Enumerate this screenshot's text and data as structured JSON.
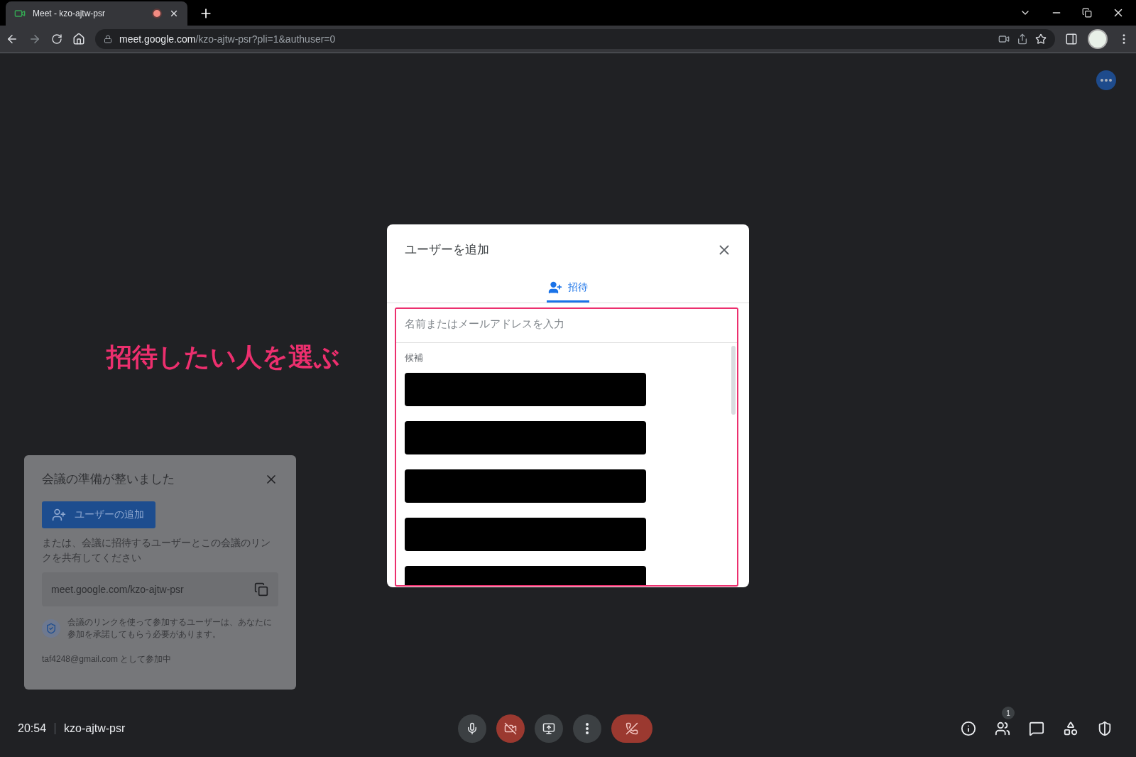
{
  "browser": {
    "tab": {
      "title": "Meet - kzo-ajtw-psr",
      "recording": true
    },
    "url": {
      "host": "meet.google.com",
      "path": "/kzo-ajtw-psr?pli=1&authuser=0"
    }
  },
  "annotation": {
    "text": "招待したい人を選ぶ"
  },
  "dialog": {
    "title": "ユーザーを追加",
    "tabs": [
      {
        "label": "招待",
        "selected": true
      }
    ],
    "search": {
      "placeholder": "名前またはメールアドレスを入力"
    },
    "suggestions": {
      "heading": "候補",
      "rows": [
        {
          "kind": "redacted"
        },
        {
          "kind": "redacted"
        },
        {
          "kind": "redacted"
        },
        {
          "kind": "redacted"
        },
        {
          "kind": "redacted"
        }
      ]
    }
  },
  "ready_card": {
    "title": "会議の準備が整いました",
    "add_button": "ユーザーの追加",
    "description": "または、会議に招待するユーザーとこの会議のリンクを共有してください",
    "link": "meet.google.com/kzo-ajtw-psr",
    "notice": "会議のリンクを使って参加するユーザーは、あなたに参加を承諾してもらう必要があります。",
    "joined_as": "taf4248@gmail.com として参加中"
  },
  "bottom_bar": {
    "time": "20:54",
    "meeting_code": "kzo-ajtw-psr",
    "controls": [
      {
        "kind": "mic"
      },
      {
        "kind": "camera-off"
      },
      {
        "kind": "present"
      },
      {
        "kind": "more"
      },
      {
        "kind": "end-call"
      }
    ],
    "side_buttons": [
      {
        "kind": "info"
      },
      {
        "kind": "people",
        "badge": "1"
      },
      {
        "kind": "chat"
      },
      {
        "kind": "activities"
      },
      {
        "kind": "host-controls"
      }
    ]
  }
}
